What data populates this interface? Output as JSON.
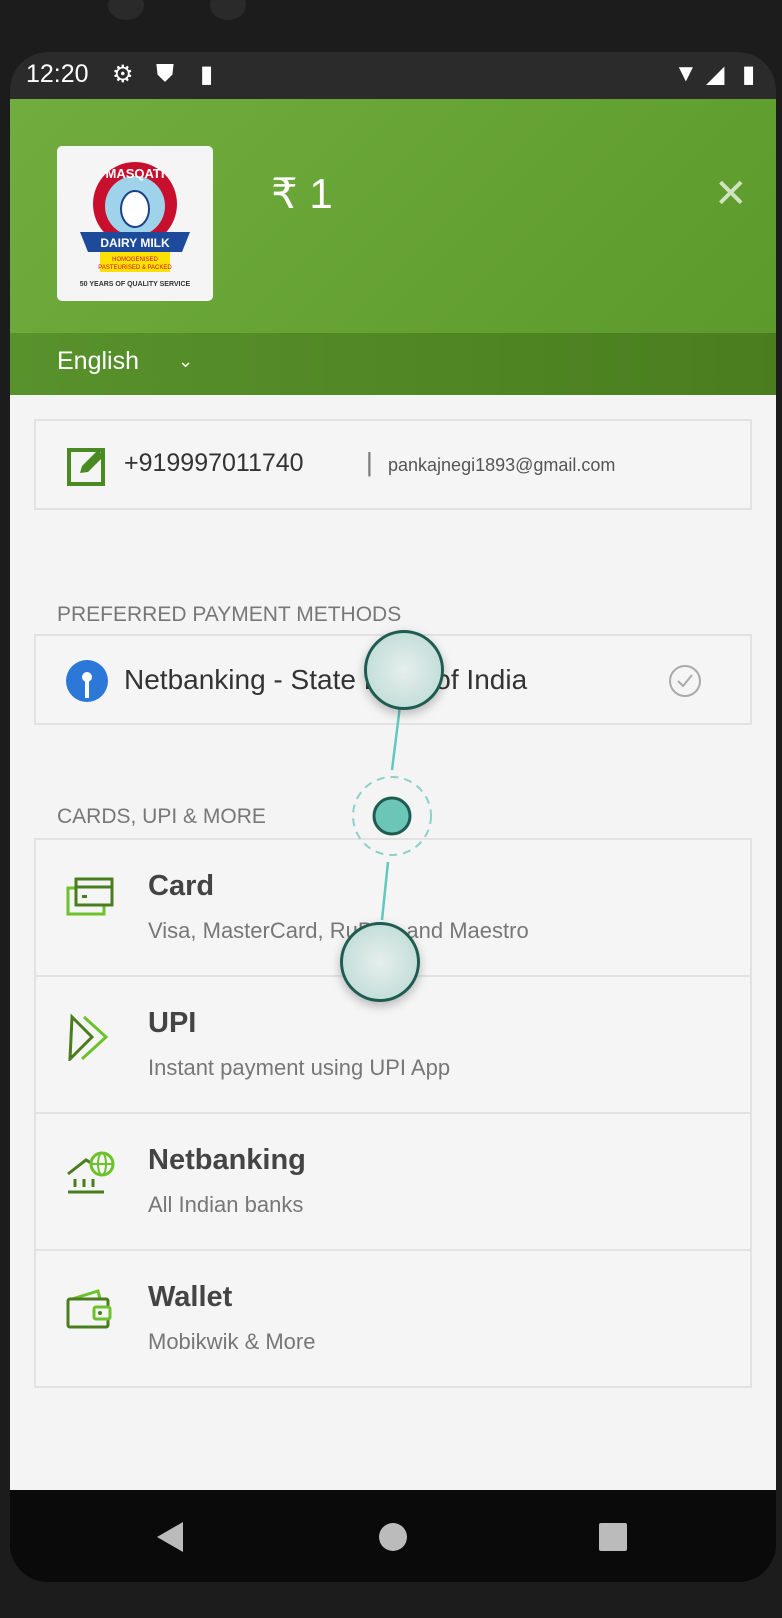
{
  "status_bar": {
    "time": "12:20",
    "icons": [
      "gear-icon",
      "shield-play-icon",
      "sd-card-icon",
      "wifi-icon",
      "signal-icon",
      "battery-icon"
    ]
  },
  "header": {
    "merchant_logo": "MASQATI DAIRY MILK - HOMOGENISED PASTEURISED & PACKED - 50 YEARS OF QUALITY SERVICE",
    "amount": "₹ 1",
    "close_icon": "close-icon"
  },
  "language": {
    "selected": "English"
  },
  "contact": {
    "phone": "+919997011740",
    "separator": "|",
    "email": "pankajnegi1893@gmail.com"
  },
  "preferred": {
    "heading": "PREFERRED PAYMENT METHODS",
    "items": [
      {
        "label": "Netbanking - State Bank of India"
      }
    ]
  },
  "methods": {
    "heading": "CARDS, UPI & MORE",
    "items": [
      {
        "title": "Card",
        "subtitle": "Visa, MasterCard, RuPay, and Maestro"
      },
      {
        "title": "UPI",
        "subtitle": "Instant payment using UPI App"
      },
      {
        "title": "Netbanking",
        "subtitle": "All Indian banks"
      },
      {
        "title": "Wallet",
        "subtitle": "Mobikwik & More"
      }
    ]
  },
  "colors": {
    "brand_green": "#6aa538",
    "icon_dark": "#4a7d1e",
    "icon_light": "#6cc22a",
    "touch": "#6cc6b8"
  }
}
